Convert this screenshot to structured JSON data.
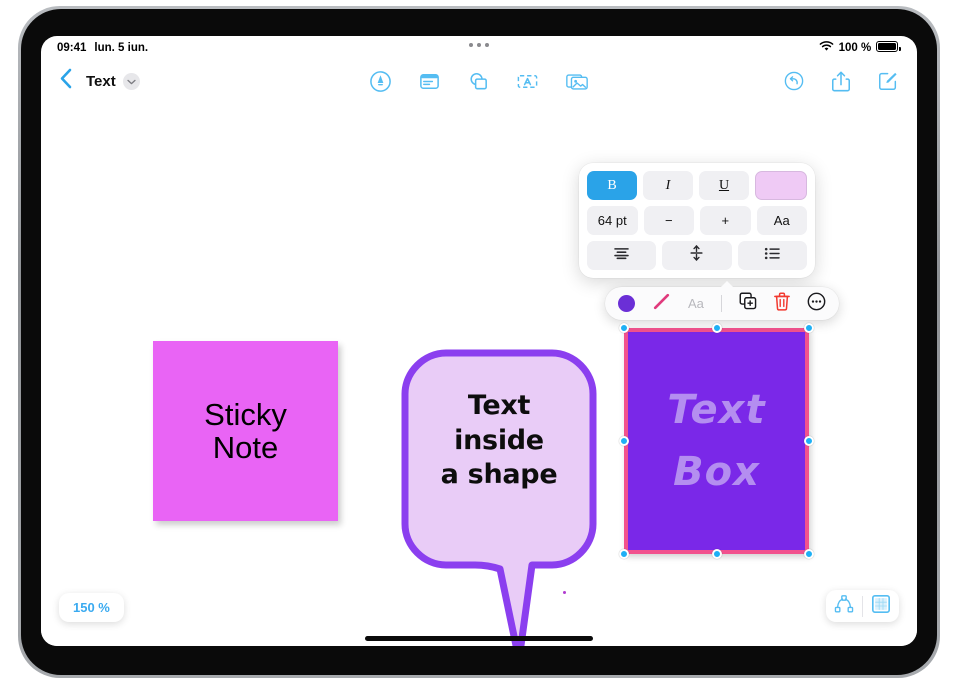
{
  "status_bar": {
    "time": "09:41",
    "date": "lun. 5 iun.",
    "battery_percent": "100 %",
    "wifi_icon": "wifi-icon",
    "battery_icon": "battery-icon",
    "multitask_icon": "multitask-dots-icon"
  },
  "nav_bar": {
    "back_icon": "chevron-left-icon",
    "title": "Text",
    "title_chevron_icon": "chevron-down-icon",
    "center_tools": [
      {
        "name": "markup-pen-tool",
        "icon": "pen-in-circle-icon"
      },
      {
        "name": "sticky-note-tool",
        "icon": "sticky-note-icon"
      },
      {
        "name": "shapes-tool",
        "icon": "shapes-icon"
      },
      {
        "name": "text-box-tool",
        "icon": "text-box-icon"
      },
      {
        "name": "media-tool",
        "icon": "photo-stack-icon"
      }
    ],
    "right_tools": [
      {
        "name": "undo-button",
        "icon": "undo-arrow-icon"
      },
      {
        "name": "share-button",
        "icon": "share-up-arrow-icon"
      },
      {
        "name": "compose-button",
        "icon": "compose-pencil-icon"
      }
    ]
  },
  "format_popup": {
    "bold_label": "B",
    "italic_label": "I",
    "underline_label": "U",
    "color_swatch": "#efcaf5",
    "font_size": "64 pt",
    "decrease_label": "−",
    "increase_label": "+",
    "font_style_label": "Aa",
    "align_icon": "align-center-icon",
    "line_spacing_icon": "line-spacing-icon",
    "list_icon": "bulleted-list-icon",
    "bold_active": true
  },
  "action_bar": {
    "fill_color": "#6b2fd6",
    "stroke_color": "#e03a7c",
    "fill_icon": "fill-color-circle-icon",
    "stroke_icon": "stroke-color-line-icon",
    "text_style_label": "Aa",
    "duplicate_icon": "duplicate-icon",
    "delete_icon": "trash-icon",
    "delete_color": "#f2392f",
    "more_icon": "more-ellipsis-circle-icon"
  },
  "canvas": {
    "sticky_note": {
      "text": "Sticky\nNote",
      "fill": "#e964f5",
      "text_color": "#000000"
    },
    "shape_bubble": {
      "text": "Text\ninside\na shape",
      "fill": "#e9ccf7",
      "stroke": "#8b3fef",
      "text_color": "#0d0d0d"
    },
    "text_box": {
      "text": "Text\nBox",
      "fill": "#7a28e8",
      "border": "#f2528e",
      "text_color": "#b48ef0",
      "selected": true,
      "handle_color": "#1eb0f5"
    }
  },
  "bottom": {
    "zoom_level": "150 %",
    "zoom_color": "#3aaaf0",
    "connector_icon": "node-connector-icon",
    "frame_icon": "frame-grid-icon"
  }
}
